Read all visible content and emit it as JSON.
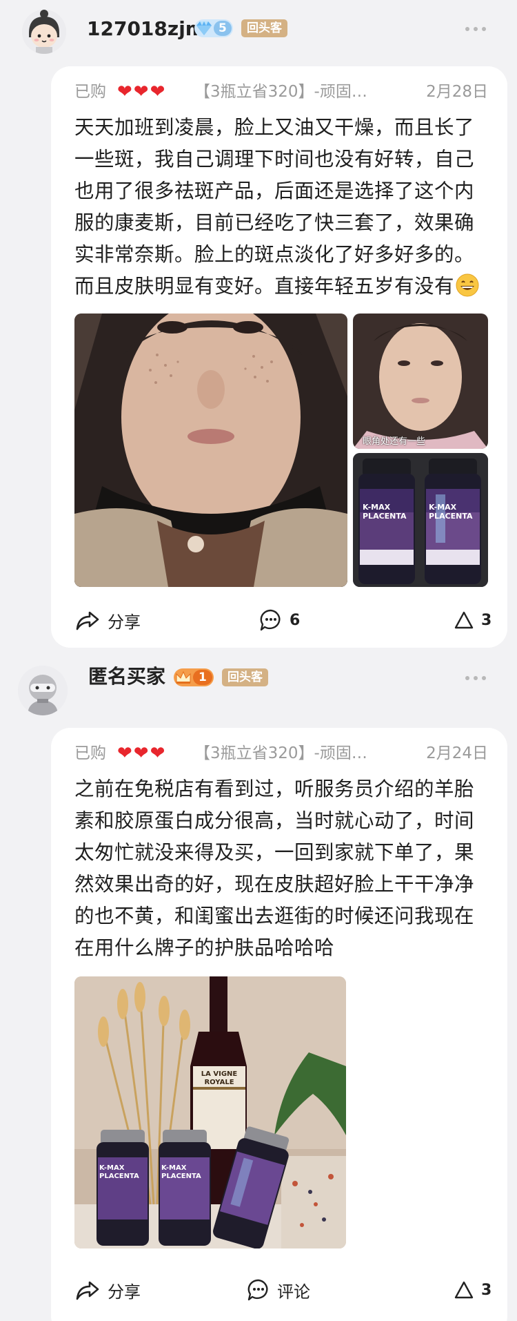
{
  "posts": [
    {
      "username": "127018zjm",
      "level": "5",
      "return_badge": "回头客",
      "bought": "已购",
      "hearts": "❤❤❤",
      "product": "【3瓶立省320】-顽固斑…",
      "date": "2月28日",
      "review": "天天加班到凌晨，脸上又油又干燥，而且长了一些斑，我自己调理下时间也没有好转，自己也用了很多祛斑产品，后面还是选择了这个内服的康麦斯，目前已经吃了快三套了，效果确实非常奈斯。脸上的斑点淡化了好多好多的。而且皮肤明显有变好。直接年轻五岁有没有",
      "image_overlay_text": "眼角处还有一些",
      "bottle_label": "K-MAX PLACENTA",
      "share_label": "分享",
      "comment_count": "6",
      "like_count": "3"
    },
    {
      "username": "匿名买家",
      "level": "1",
      "return_badge": "回头客",
      "bought": "已购",
      "hearts": "❤❤❤",
      "product": "【3瓶立省320】-顽固斑…",
      "date": "2月24日",
      "review": "之前在免税店有看到过，听服务员介绍的羊胎素和胶原蛋白成分很高，当时就心动了，时间太匆忙就没来得及买，一回到家就下单了，果然效果出奇的好，现在皮肤超好脸上干干净净的也不黄，和闺蜜出去逛街的时候还问我现在在用什么牌子的护肤品哈哈哈",
      "wine_label": "LA VIGNE ROYALE",
      "bottle_label": "K-MAX PLACENTA",
      "share_label": "分享",
      "comment_label": "评论",
      "like_count": "3"
    }
  ],
  "colors": {
    "page_bg": "#f2f2f4",
    "card_bg": "#ffffff",
    "heart": "#e8262d",
    "return_badge": "#d4b184",
    "diamond_badge": "#7fc0f5",
    "crown_badge": "#f08a3c",
    "muted_text": "#9a9a9a"
  },
  "icons": [
    "diamond-icon",
    "crown-icon",
    "more-icon",
    "share-icon",
    "comment-icon",
    "like-icon",
    "grin-emoji-icon"
  ]
}
